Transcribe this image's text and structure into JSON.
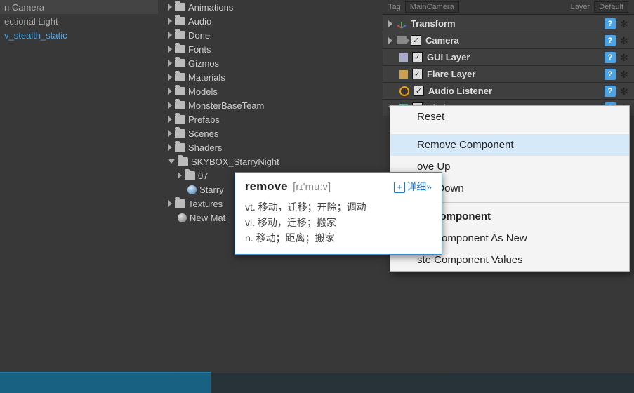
{
  "hierarchy": {
    "item0": "n Camera",
    "item1": "ectional Light",
    "item2": "v_stealth_static"
  },
  "project": {
    "items": [
      {
        "label": "Animations",
        "open": false
      },
      {
        "label": "Audio",
        "open": false
      },
      {
        "label": "Done",
        "open": false
      },
      {
        "label": "Fonts",
        "open": false
      },
      {
        "label": "Gizmos",
        "open": false
      },
      {
        "label": "Materials",
        "open": false
      },
      {
        "label": "Models",
        "open": false
      },
      {
        "label": "MonsterBaseTeam",
        "open": false
      },
      {
        "label": "Prefabs",
        "open": false
      },
      {
        "label": "Scenes",
        "open": false
      },
      {
        "label": "Shaders",
        "open": false
      }
    ],
    "skybox_folder": "SKYBOX_StarryNight",
    "sub07": "07",
    "subStarry": "Starry",
    "textures": "Textures",
    "newMat": "New Mat"
  },
  "inspector": {
    "tagLabel": "Tag",
    "tagValue": "MainCamera",
    "layerLabel": "Layer",
    "layerValue": "Default",
    "components": {
      "transform": "Transform",
      "camera": "Camera",
      "guiLayer": "GUI Layer",
      "flareLayer": "Flare Layer",
      "audioListener": "Audio Listener",
      "skybox": "Skybox"
    }
  },
  "contextMenu": {
    "reset": "Reset",
    "remove": "Remove Component",
    "moveUp": "ove Up",
    "moveDown": "ove Down",
    "copy": "py Component",
    "pasteNew": "ste Component As New",
    "pasteVals": "ste Component Values"
  },
  "dict": {
    "word": "remove",
    "pron": "[rɪ'muːv]",
    "more": "详细»",
    "line1": "vt.  移动，迁移；开除；调动",
    "line2": "vi.  移动，迁移；搬家",
    "line3": "n.  移动；距离；搬家"
  }
}
